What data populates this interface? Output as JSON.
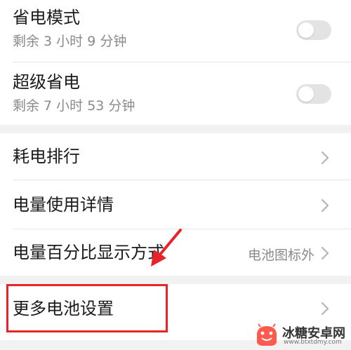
{
  "settings": {
    "power_saving": {
      "title": "省电模式",
      "subtitle": "剩余 3 小时 9 分钟",
      "enabled": false
    },
    "ultra_power_saving": {
      "title": "超级省电",
      "subtitle": "剩余 7 小时 53 分钟",
      "enabled": false
    },
    "power_ranking": {
      "title": "耗电排行"
    },
    "usage_details": {
      "title": "电量使用详情"
    },
    "percentage_display": {
      "title": "电量百分比显示方式",
      "value": "电池图标外"
    },
    "more_battery_settings": {
      "title": "更多电池设置"
    }
  },
  "annotation": {
    "highlight_color": "#e8242a"
  },
  "watermark": {
    "name": "冰糖安卓网",
    "url": "www.btxtdmy.com"
  }
}
